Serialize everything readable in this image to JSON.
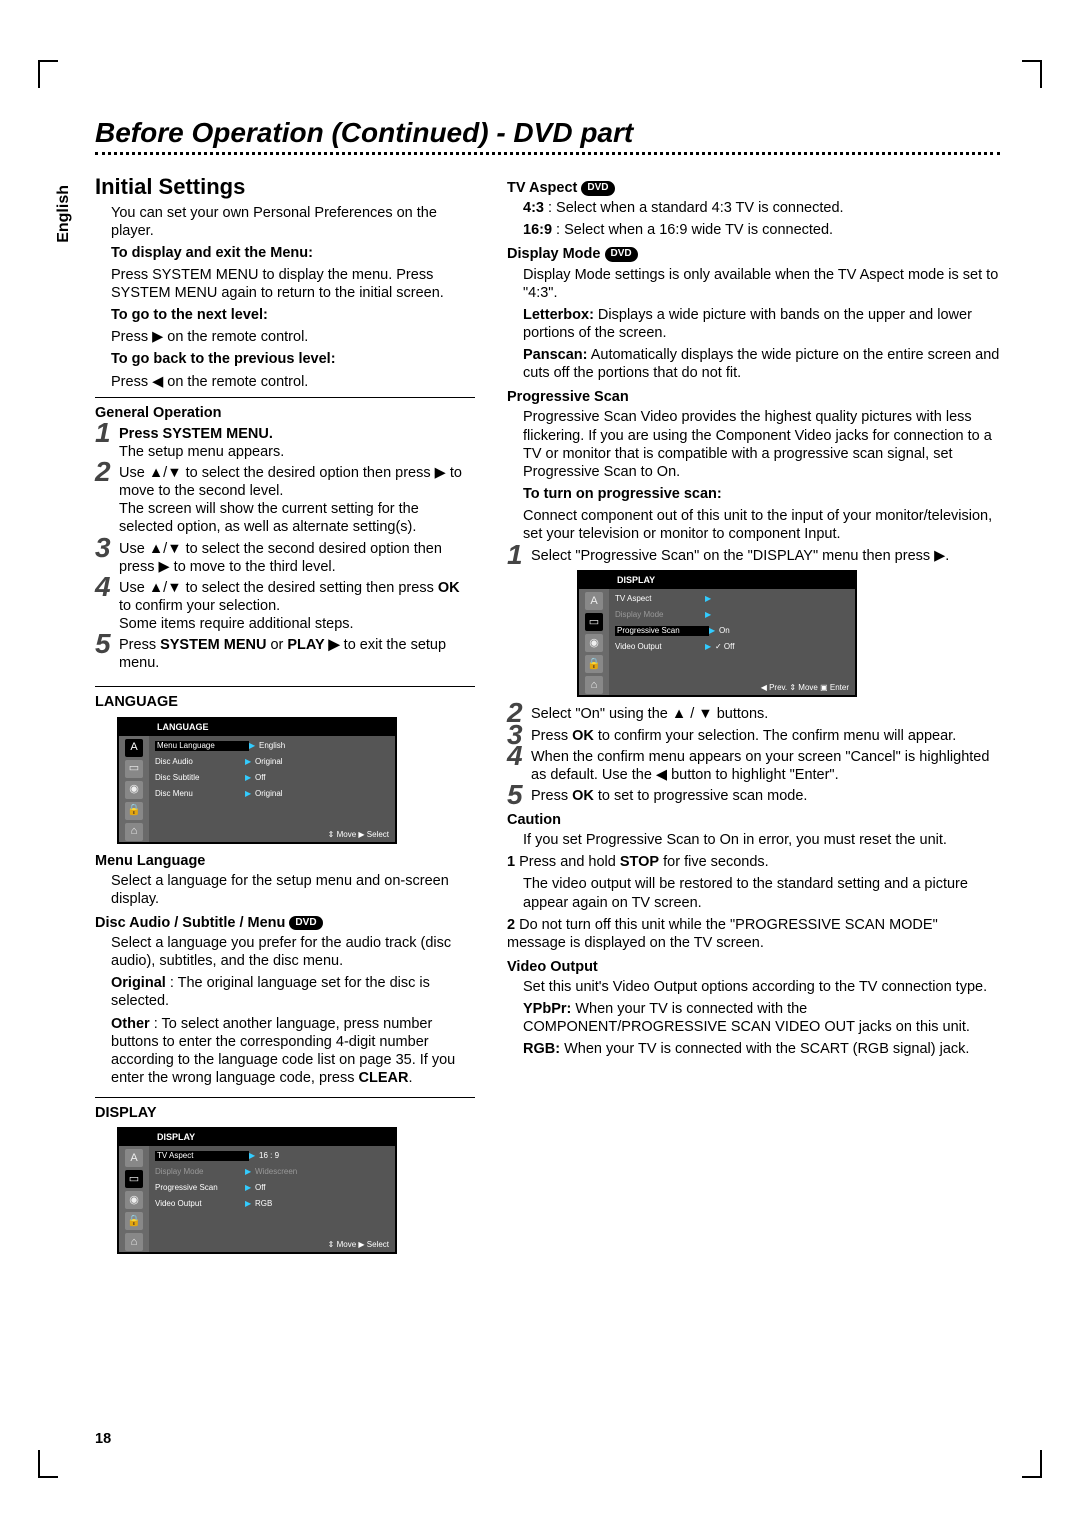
{
  "meta": {
    "language_tab": "English",
    "page_number": "18"
  },
  "title": "Before Operation (Continued) - DVD part",
  "left": {
    "h2": "Initial Settings",
    "intro": "You can set your own Personal Preferences on the player.",
    "display_exit_head": "To display and exit the Menu:",
    "display_exit_body": "Press SYSTEM MENU to display the menu. Press SYSTEM MENU again to return to the initial screen.",
    "next_level_head": "To go to the next level:",
    "next_level_body": "Press ▶ on the remote control.",
    "prev_level_head": "To go back to the previous level:",
    "prev_level_body": "Press ◀ on the remote control.",
    "genop": "General Operation",
    "step1_h": "Press SYSTEM MENU.",
    "step1_b": "The setup menu appears.",
    "step2": "Use ▲/▼ to select the desired option then press ▶ to move to the second level.",
    "step2b": "The screen will show the current setting for the selected option, as well as alternate setting(s).",
    "step3": "Use ▲/▼ to select the second desired option then press ▶ to move to the third level.",
    "step4a": "Use ▲/▼ to select the desired setting then press ",
    "step4ok": "OK",
    "step4b": " to confirm your selection.",
    "step4c": "Some items require additional steps.",
    "step5a": "Press ",
    "step5sm": "SYSTEM MENU",
    "step5or": " or ",
    "step5play": "PLAY ▶",
    "step5b": " to exit the setup menu.",
    "lang_head": "LANGUAGE",
    "menu_lang_h": "Menu Language",
    "menu_lang_b": "Select a language for the setup menu and on-screen display.",
    "disc_asm_h": "Disc Audio / Subtitle / Menu",
    "disc_asm_1": "Select a language you prefer for the audio track (disc audio), subtitles, and the disc menu.",
    "disc_asm_orig_l": "Original",
    "disc_asm_orig": " : The original language set for the disc is selected.",
    "disc_asm_other_l": "Other",
    "disc_asm_other": " : To select another language, press number buttons to enter the corresponding 4-digit number according to the language code list on page 35. If you enter the wrong language code, press ",
    "disc_asm_clear": "CLEAR",
    "display_head": "DISPLAY",
    "dvd_badge": "DVD"
  },
  "right": {
    "tvaspect_h": "TV Aspect",
    "tvaspect_43l": "4:3",
    "tvaspect_43": " : Select when a standard 4:3 TV is connected.",
    "tvaspect_169l": "16:9",
    "tvaspect_169": " : Select when a 16:9 wide TV is connected.",
    "dispmode_h": "Display Mode",
    "dispmode_1": "Display Mode settings is only available when the TV Aspect mode is set to \"4:3\".",
    "letterbox_l": "Letterbox:",
    "letterbox": " Displays a wide picture with bands on the upper and lower portions of the screen.",
    "panscan_l": "Panscan:",
    "panscan": " Automatically displays the wide picture on the entire screen and cuts off the portions that do not fit.",
    "prog_h": "Progressive Scan",
    "prog_1": "Progressive Scan Video provides the highest quality pictures with less flickering. If you are using the Component Video jacks for connection to a TV or monitor that is compatible with a progressive scan signal, set Progressive Scan to On.",
    "prog_turnon_h": "To turn on progressive scan:",
    "prog_turnon_b": "Connect component out of this unit to the input of your monitor/television, set your television or monitor to component Input.",
    "pstep1": "Select \"Progressive Scan\" on the \"DISPLAY\" menu then press ▶.",
    "pstep2": "Select \"On\" using the ▲ / ▼ buttons.",
    "pstep3a": "Press ",
    "pstep3b": " to confirm your selection. The confirm menu will appear.",
    "pstep4": "When the confirm menu appears on your screen \"Cancel\" is highlighted as default. Use the ◀ button to highlight \"Enter\".",
    "pstep5a": "Press ",
    "pstep5b": " to set to progressive scan mode.",
    "caution_h": "Caution",
    "caution_1": "If you set Progressive Scan to On in error, you must reset the unit.",
    "c1a": "1",
    "c1b": "Press and hold ",
    "c1stop": "STOP",
    "c1c": " for five seconds.",
    "c1d": "The video output will be restored to the standard setting and a picture appear again on TV screen.",
    "c2a": "2",
    "c2b": "Do not turn off this unit while the \"PROGRESSIVE SCAN MODE\" message is displayed on the TV screen.",
    "vout_h": "Video Output",
    "vout_1": "Set this unit's Video Output options according to the TV connection type.",
    "ypbpr_l": "YPbPr:",
    "ypbpr": " When your TV is connected with the COMPONENT/PROGRESSIVE SCAN VIDEO OUT jacks on this unit.",
    "rgb_l": "RGB:",
    "rgb": " When your TV is connected with the SCART (RGB signal) jack."
  },
  "osd": {
    "lang": {
      "title": "LANGUAGE",
      "rows": [
        {
          "l": "Menu Language",
          "v": "English",
          "hl": true
        },
        {
          "l": "Disc Audio",
          "v": "Original"
        },
        {
          "l": "Disc Subtitle",
          "v": "Off"
        },
        {
          "l": "Disc Menu",
          "v": "Original"
        }
      ],
      "foot": "⇕ Move   ▶ Select"
    },
    "disp1": {
      "title": "DISPLAY",
      "rows": [
        {
          "l": "TV Aspect",
          "v": "16 : 9",
          "hl": true
        },
        {
          "l": "Display Mode",
          "v": "Widescreen",
          "dim": true
        },
        {
          "l": "Progressive Scan",
          "v": "Off"
        },
        {
          "l": "Video Output",
          "v": "RGB"
        }
      ],
      "foot": "⇕ Move   ▶ Select"
    },
    "disp2": {
      "title": "DISPLAY",
      "rows": [
        {
          "l": "TV Aspect",
          "v": ""
        },
        {
          "l": "Display Mode",
          "v": "",
          "dim": true
        },
        {
          "l": "Progressive Scan",
          "v": "On",
          "hl": true
        },
        {
          "l": "Video Output",
          "v": "✓ Off"
        }
      ],
      "foot": "◀ Prev.   ⇕ Move   ▣ Enter"
    }
  }
}
